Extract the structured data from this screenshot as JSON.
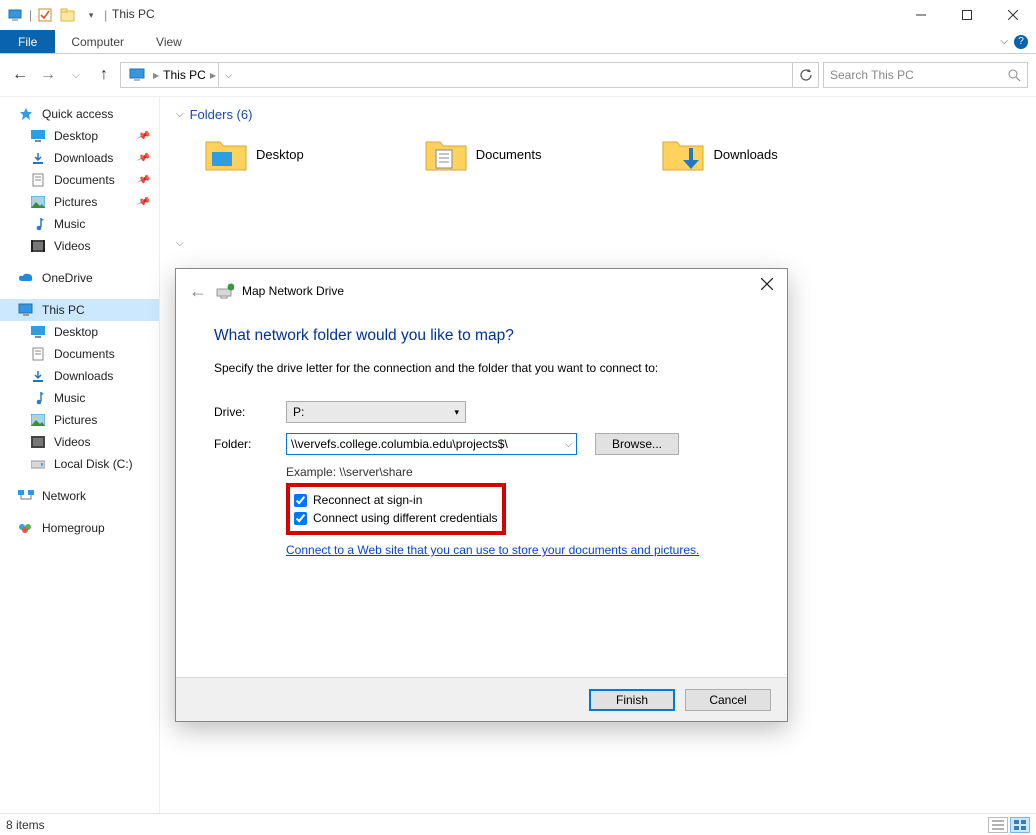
{
  "window": {
    "title": "This PC",
    "tabs": {
      "file": "File",
      "computer": "Computer",
      "view": "View"
    }
  },
  "nav": {
    "breadcrumb": "This PC",
    "search_placeholder": "Search This PC"
  },
  "sidebar": {
    "quick_access": "Quick access",
    "qa_items": [
      {
        "label": "Desktop"
      },
      {
        "label": "Downloads"
      },
      {
        "label": "Documents"
      },
      {
        "label": "Pictures"
      },
      {
        "label": "Music"
      },
      {
        "label": "Videos"
      }
    ],
    "onedrive": "OneDrive",
    "this_pc": "This PC",
    "pc_items": [
      {
        "label": "Desktop"
      },
      {
        "label": "Documents"
      },
      {
        "label": "Downloads"
      },
      {
        "label": "Music"
      },
      {
        "label": "Pictures"
      },
      {
        "label": "Videos"
      },
      {
        "label": "Local Disk (C:)"
      }
    ],
    "network": "Network",
    "homegroup": "Homegroup"
  },
  "content": {
    "group_label": "Folders (6)",
    "folders": [
      {
        "label": "Desktop"
      },
      {
        "label": "Documents"
      },
      {
        "label": "Downloads"
      }
    ]
  },
  "status": {
    "text": "8 items"
  },
  "dialog": {
    "title": "Map Network Drive",
    "heading": "What network folder would you like to map?",
    "subtext": "Specify the drive letter for the connection and the folder that you want to connect to:",
    "drive_label": "Drive:",
    "drive_value": "P:",
    "folder_label": "Folder:",
    "folder_value": "\\\\vervefs.college.columbia.edu\\projects$\\",
    "browse": "Browse...",
    "example": "Example: \\\\server\\share",
    "check_reconnect": "Reconnect at sign-in",
    "check_creds": "Connect using different credentials",
    "website_link_text": "Connect to a Web site that you can use to store your documents and pictures",
    "finish": "Finish",
    "cancel": "Cancel"
  }
}
